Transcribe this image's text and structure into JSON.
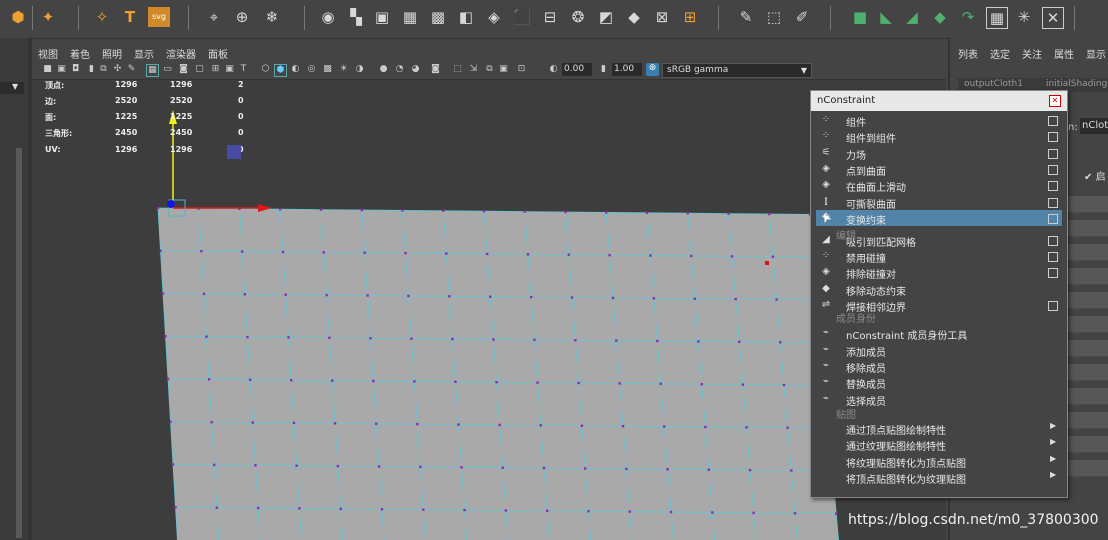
{
  "viewport_menu": [
    "视图",
    "着色",
    "照明",
    "显示",
    "渲染器",
    "面板"
  ],
  "viewport_toolbar": {
    "field1": "0.00",
    "field2": "1.00",
    "color_space": "sRGB gamma"
  },
  "hud": {
    "rows": [
      {
        "label": "顶点:",
        "v1": "1296",
        "v2": "1296",
        "v3": "2"
      },
      {
        "label": "边:",
        "v1": "2520",
        "v2": "2520",
        "v3": "0"
      },
      {
        "label": "面:",
        "v1": "1225",
        "v2": "1225",
        "v3": "0"
      },
      {
        "label": "三角形:",
        "v1": "2450",
        "v2": "2450",
        "v3": "0"
      },
      {
        "label": "UV:",
        "v1": "1296",
        "v2": "1296",
        "v3": "0"
      }
    ]
  },
  "right_panel": {
    "menu": [
      "列表",
      "选定",
      "关注",
      "属性",
      "显示"
    ],
    "tabs": [
      "outputCloth1",
      "initialShading"
    ],
    "field_label": "n:",
    "field_value": "nClot",
    "checkbox_label": "启"
  },
  "menu_window": {
    "title": "nConstraint",
    "sections": {
      "edit": "编辑",
      "membership": "成员身份",
      "maps": "贴图"
    },
    "items": [
      {
        "label": "组件",
        "icon": "component-constraint-icon"
      },
      {
        "label": "组件到组件",
        "icon": "component-to-component-icon"
      },
      {
        "label": "力场",
        "icon": "force-field-icon"
      },
      {
        "label": "点到曲面",
        "icon": "point-to-surface-icon"
      },
      {
        "label": "在曲面上滑动",
        "icon": "slide-on-surface-icon"
      },
      {
        "label": "可撕裂曲面",
        "icon": "tearable-surface-icon"
      },
      {
        "label": "变换约束",
        "icon": "transform-constraint-icon"
      },
      {
        "label": "吸引到匹配网格",
        "icon": "attract-to-matching-mesh-icon"
      },
      {
        "label": "禁用碰撞",
        "icon": "disable-collision-icon"
      },
      {
        "label": "排除碰撞对",
        "icon": "exclude-collide-pairs-icon"
      },
      {
        "label": "移除动态约束",
        "icon": "remove-dynamic-constraint-icon"
      },
      {
        "label": "焊接相邻边界",
        "icon": "weld-adjacent-borders-icon"
      },
      {
        "label": "nConstraint 成员身份工具",
        "icon": "membership-tool-icon"
      },
      {
        "label": "添加成员",
        "icon": "add-members-icon"
      },
      {
        "label": "移除成员",
        "icon": "remove-members-icon"
      },
      {
        "label": "替换成员",
        "icon": "replace-members-icon"
      },
      {
        "label": "选择成员",
        "icon": "select-members-icon"
      },
      {
        "label": "通过顶点贴图绘制特性",
        "icon": ""
      },
      {
        "label": "通过纹理贴图绘制特性",
        "icon": ""
      },
      {
        "label": "将纹理贴图转化为顶点贴图",
        "icon": ""
      },
      {
        "label": "将顶点贴图转化为纹理贴图",
        "icon": ""
      }
    ]
  },
  "watermark": "https://blog.csdn.net/m0_37800300",
  "colors": {
    "highlight": "#5284a8",
    "mesh_face": "#a9a9a9",
    "mesh_edge": "#63c7d8",
    "vertex": "#8e2ab0"
  }
}
